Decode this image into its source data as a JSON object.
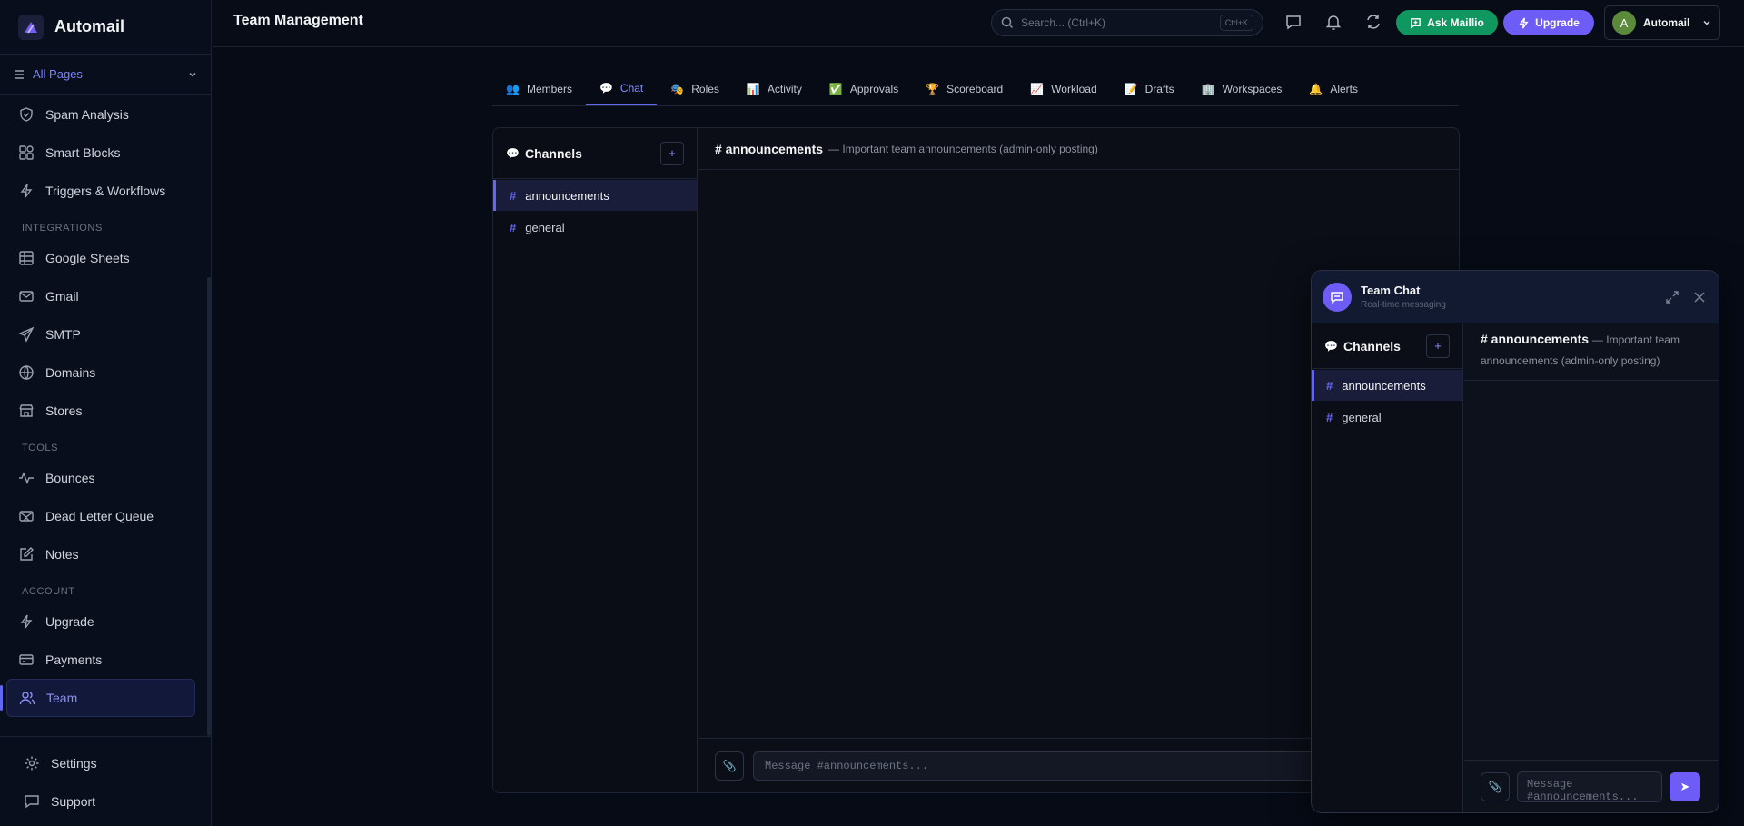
{
  "app": {
    "name": "Automail"
  },
  "sidebar": {
    "all_pages_label": "All Pages",
    "items": [
      {
        "label": "Spam Analysis",
        "icon": "shield-icon"
      },
      {
        "label": "Smart Blocks",
        "icon": "blocks-icon"
      },
      {
        "label": "Triggers & Workflows",
        "icon": "zap-icon"
      }
    ],
    "integrations_heading": "INTEGRATIONS",
    "integrations": [
      {
        "label": "Google Sheets",
        "icon": "table-icon"
      },
      {
        "label": "Gmail",
        "icon": "mail-icon"
      },
      {
        "label": "SMTP",
        "icon": "send-icon"
      },
      {
        "label": "Domains",
        "icon": "globe-icon"
      },
      {
        "label": "Stores",
        "icon": "store-icon"
      }
    ],
    "tools_heading": "TOOLS",
    "tools": [
      {
        "label": "Bounces",
        "icon": "activity-icon"
      },
      {
        "label": "Dead Letter Queue",
        "icon": "mail-x-icon"
      },
      {
        "label": "Notes",
        "icon": "edit-icon"
      }
    ],
    "account_heading": "ACCOUNT",
    "account": [
      {
        "label": "Upgrade",
        "icon": "zap-icon"
      },
      {
        "label": "Payments",
        "icon": "credit-card-icon"
      },
      {
        "label": "Team",
        "icon": "users-icon",
        "active": true
      }
    ],
    "bottom": [
      {
        "label": "Settings",
        "icon": "gear-icon"
      },
      {
        "label": "Support",
        "icon": "message-icon"
      }
    ]
  },
  "topbar": {
    "title": "Team Management",
    "search_placeholder": "Search... (Ctrl+K)",
    "search_shortcut": "Ctrl+K",
    "ask_label": "Ask Maillio",
    "upgrade_label": "Upgrade",
    "user_initial": "A",
    "user_name": "Automail"
  },
  "tabs": [
    {
      "label": "Members",
      "icon": "👥"
    },
    {
      "label": "Chat",
      "icon": "💬",
      "active": true
    },
    {
      "label": "Roles",
      "icon": "🎭"
    },
    {
      "label": "Activity",
      "icon": "📊"
    },
    {
      "label": "Approvals",
      "icon": "✅"
    },
    {
      "label": "Scoreboard",
      "icon": "🏆"
    },
    {
      "label": "Workload",
      "icon": "📈"
    },
    {
      "label": "Drafts",
      "icon": "📝"
    },
    {
      "label": "Workspaces",
      "icon": "🏢"
    },
    {
      "label": "Alerts",
      "icon": "🔔"
    }
  ],
  "chat": {
    "channels_title": "Channels",
    "channels_icon": "💬",
    "add_label": "+",
    "channels": [
      {
        "name": "announcements",
        "active": true
      },
      {
        "name": "general"
      }
    ],
    "current_channel": "# announcements",
    "current_description": "— Important team announcements (admin-only posting)",
    "message_placeholder": "Message #announcements...",
    "attach_icon": "📎"
  },
  "widget": {
    "title": "Team Chat",
    "subtitle": "Real-time messaging",
    "channels_title": "Channels",
    "channels_icon": "💬",
    "add_label": "+",
    "channels": [
      {
        "name": "announcements",
        "active": true
      },
      {
        "name": "general"
      }
    ],
    "current_channel": "# announcements",
    "current_description": "— Important team announcements (admin-only posting)",
    "message_placeholder": "Message #announcements...",
    "attach_icon": "📎",
    "send_icon": "➤"
  },
  "colors": {
    "accent": "#6366f1",
    "green": "#10975f",
    "purple": "#6d5cf6",
    "background": "#060b16"
  }
}
